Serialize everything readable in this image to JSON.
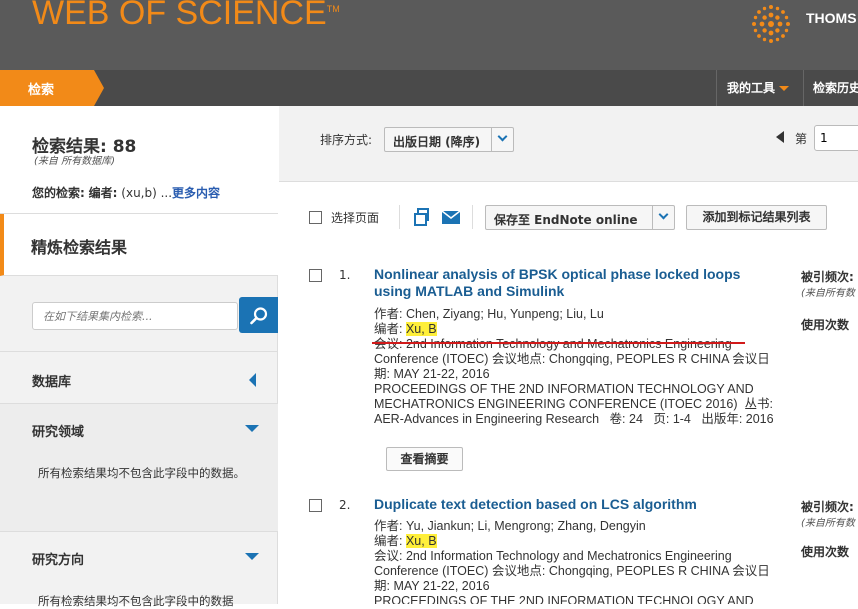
{
  "header": {
    "logo_text": "WEB OF SCIENCE",
    "logo_tm": "TM",
    "brand": "THOMS",
    "brand_color": "#f28a18"
  },
  "nav": {
    "search_tab": "检索",
    "my_tools": "我的工具",
    "search_history": "检索历史"
  },
  "sidebar": {
    "result_count": "检索结果: 88",
    "result_sub": "(来自 所有数据库)",
    "your_search_label": "您的检索:",
    "your_search_field": "编者:",
    "your_search_value": "(xu,b) ...",
    "more_link": "更多内容",
    "refine_title": "精炼检索结果",
    "filter_placeholder": "在如下结果集内检索...",
    "sections": [
      {
        "title": "数据库",
        "note": ""
      },
      {
        "title": "研究领域",
        "note": "所有检索结果均不包含此字段中的数据。"
      },
      {
        "title": "研究方向",
        "note": "所有检索结果均不包含此字段中的数据"
      }
    ]
  },
  "sort": {
    "label": "排序方式:",
    "value": "出版日期 (降序)",
    "page_label": "第",
    "page_value": "1"
  },
  "toolbar": {
    "select_page": "选择页面",
    "save_to": "保存至 EndNote online",
    "add_marked": "添加到标记结果列表"
  },
  "records": [
    {
      "num": "1.",
      "title": "Nonlinear analysis of BPSK optical phase locked loops using MATLAB and Simulink",
      "authors_label": "作者:",
      "authors": "Chen, Ziyang; Hu, Yunpeng; Liu, Lu",
      "editors_label": "编者:",
      "editors": "Xu, B",
      "conf_label": "会议:",
      "conf_name": "2nd Information Technology and Mechatronics Engineering Conference (ITOEC)",
      "conf_loc_label": "会议地点:",
      "conf_loc": "Chongqing, PEOPLES R CHINA",
      "conf_date_label": "会议日期:",
      "conf_date": "MAY 21-22, 2016",
      "proceedings": "PROCEEDINGS OF THE 2ND INFORMATION TECHNOLOGY AND MECHATRONICS ENGINEERING CONFERENCE (ITOEC 2016)",
      "series_label": "丛书:",
      "series": "AER-Advances in Engineering Research",
      "vol_label": "卷:",
      "vol": "24",
      "pages_label": "页:",
      "pages": "1-4",
      "year_label": "出版年:",
      "year": "2016",
      "abstract_btn": "查看摘要",
      "cited_label": "被引频次:",
      "cited_sub": "(来自所有数",
      "usage_label": "使用次数"
    },
    {
      "num": "2.",
      "title": "Duplicate text detection based on LCS algorithm",
      "authors_label": "作者:",
      "authors": "Yu, Jiankun; Li, Mengrong; Zhang, Dengyin",
      "editors_label": "编者:",
      "editors": "Xu, B",
      "conf_label": "会议:",
      "conf_name": "2nd Information Technology and Mechatronics Engineering Conference (ITOEC)",
      "conf_loc_label": "会议地点:",
      "conf_loc": "Chongqing, PEOPLES R CHINA",
      "conf_date_label": "会议日期:",
      "conf_date": "MAY 21-22, 2016",
      "proceedings": "PROCEEDINGS OF THE 2ND INFORMATION TECHNOLOGY AND",
      "cited_label": "被引频次:",
      "cited_sub": "(来自所有数",
      "usage_label": "使用次数"
    }
  ]
}
